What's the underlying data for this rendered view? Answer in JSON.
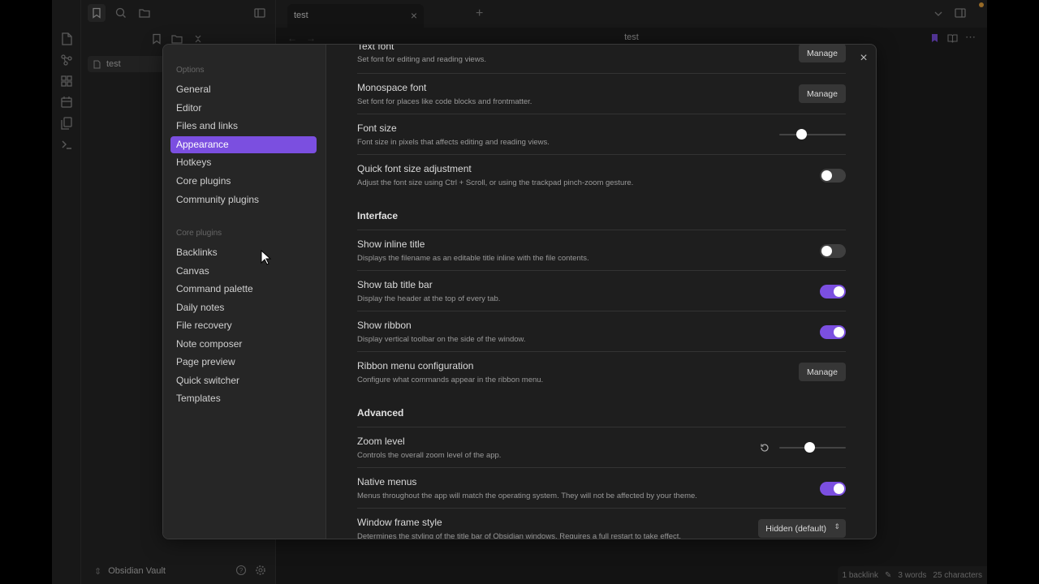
{
  "tab": {
    "title": "test",
    "close": "×",
    "new": "+"
  },
  "editor": {
    "title": "test"
  },
  "file_tree": {
    "items": [
      {
        "name": "test"
      }
    ]
  },
  "vault": {
    "name": "Obsidian Vault"
  },
  "status": {
    "backlinks": "1 backlink",
    "words": "3 words",
    "chars": "25 characters"
  },
  "settings": {
    "close": "×",
    "nav": {
      "options_label": "Options",
      "options": [
        "General",
        "Editor",
        "Files and links",
        "Appearance",
        "Hotkeys",
        "Core plugins",
        "Community plugins"
      ],
      "core_label": "Core plugins",
      "core": [
        "Backlinks",
        "Canvas",
        "Command palette",
        "Daily notes",
        "File recovery",
        "Note composer",
        "Page preview",
        "Quick switcher",
        "Templates"
      ],
      "active": "Appearance"
    },
    "rows": [
      {
        "name": "Text font",
        "desc": "Set font for editing and reading views.",
        "control": "button",
        "label": "Manage"
      },
      {
        "name": "Monospace font",
        "desc": "Set font for places like code blocks and frontmatter.",
        "control": "button",
        "label": "Manage"
      },
      {
        "name": "Font size",
        "desc": "Font size in pixels that affects editing and reading views.",
        "control": "slider",
        "value": 0.33
      },
      {
        "name": "Quick font size adjustment",
        "desc": "Adjust the font size using Ctrl + Scroll, or using the trackpad pinch-zoom gesture.",
        "control": "toggle",
        "on": false
      }
    ],
    "interface_label": "Interface",
    "interface_rows": [
      {
        "name": "Show inline title",
        "desc": "Displays the filename as an editable title inline with the file contents.",
        "control": "toggle",
        "on": false
      },
      {
        "name": "Show tab title bar",
        "desc": "Display the header at the top of every tab.",
        "control": "toggle",
        "on": true
      },
      {
        "name": "Show ribbon",
        "desc": "Display vertical toolbar on the side of the window.",
        "control": "toggle",
        "on": true
      },
      {
        "name": "Ribbon menu configuration",
        "desc": "Configure what commands appear in the ribbon menu.",
        "control": "button",
        "label": "Manage"
      }
    ],
    "advanced_label": "Advanced",
    "advanced_rows": [
      {
        "name": "Zoom level",
        "desc": "Controls the overall zoom level of the app.",
        "control": "slider",
        "value": 0.45
      },
      {
        "name": "Native menus",
        "desc": "Menus throughout the app will match the operating system. They will not be affected by your theme.",
        "control": "toggle",
        "on": true
      },
      {
        "name": "Window frame style",
        "desc": "Determines the styling of the title bar of Obsidian windows. Requires a full restart to take effect.",
        "control": "select",
        "label": "Hidden (default)"
      }
    ]
  },
  "colors": {
    "accent": "#7b4fe0",
    "bg": "#1e1e1e",
    "panel": "#262626"
  }
}
